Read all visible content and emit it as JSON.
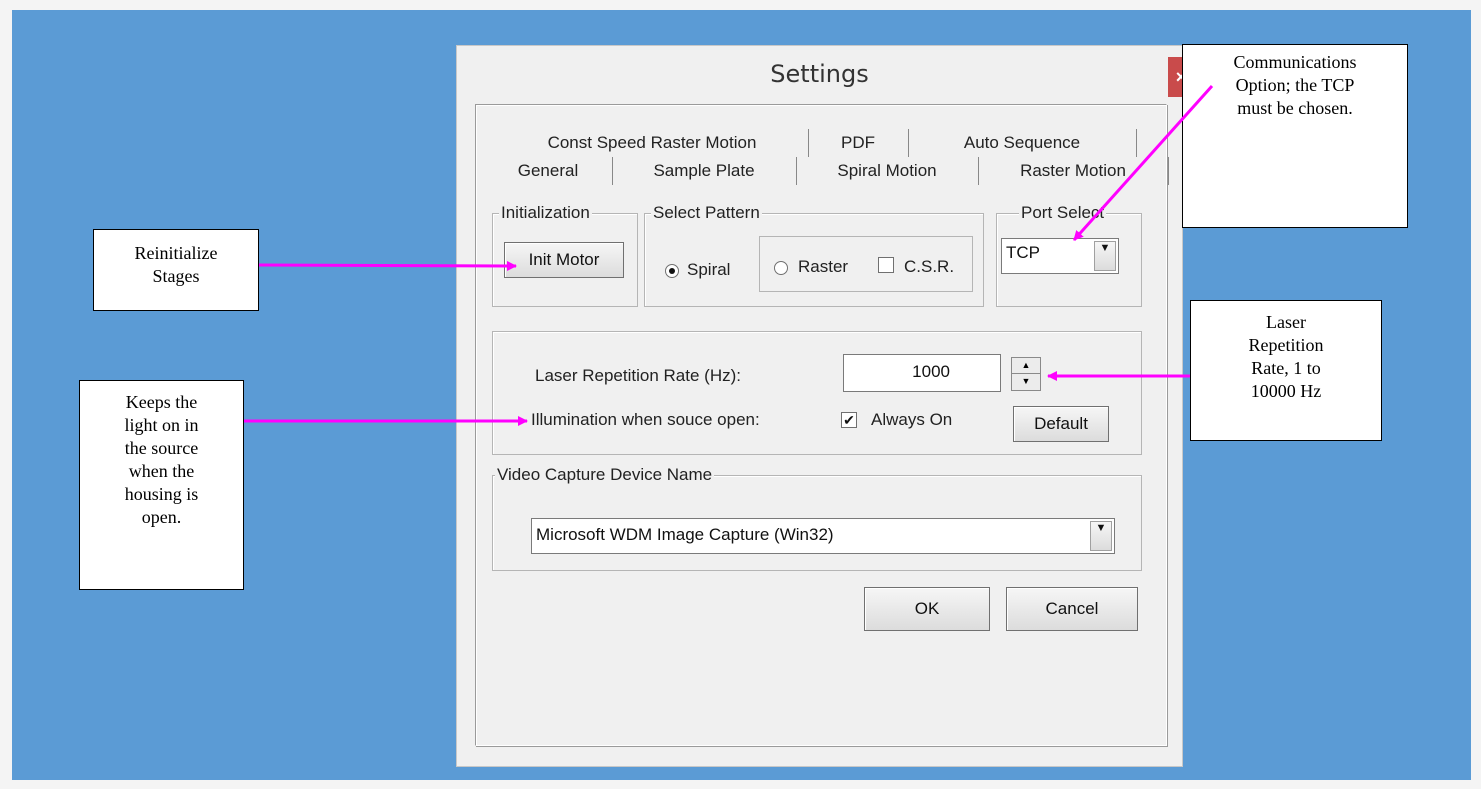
{
  "dialog": {
    "title": "Settings",
    "close_label": "×",
    "tabs_back": [
      "Const Speed Raster Motion",
      "PDF",
      "Auto Sequence"
    ],
    "tabs_front": [
      "General",
      "Sample Plate",
      "Spiral Motion",
      "Raster Motion"
    ],
    "active_tab": "General"
  },
  "initialization": {
    "title": "Initialization",
    "button_label": "Init Motor"
  },
  "select_pattern": {
    "title": "Select Pattern",
    "spiral_label": "Spiral",
    "raster_label": "Raster",
    "csr_label": "C.S.R.",
    "selected": "Spiral"
  },
  "port_select": {
    "title": "Port Select",
    "value": "TCP"
  },
  "laser": {
    "label": "Laser Repetition Rate (Hz):",
    "value": "1000"
  },
  "illumination": {
    "label": "Illumination when souce open:",
    "checkbox_label": "Always On",
    "checked": true,
    "checkmark": "✔",
    "default_label": "Default"
  },
  "video": {
    "title": "Video Capture Device Name",
    "value": "Microsoft WDM Image Capture (Win32)"
  },
  "buttons": {
    "ok": "OK",
    "cancel": "Cancel"
  },
  "annotations": {
    "reinit": [
      "Reinitialize",
      "Stages"
    ],
    "comm": [
      "Communications",
      "Option; the TCP",
      "must be chosen."
    ],
    "laser": [
      "Laser",
      "Repetition",
      "Rate, 1 to",
      "10000 Hz"
    ],
    "light": [
      "Keeps the",
      "light on in",
      "the source",
      "when the",
      "housing is",
      "open."
    ]
  },
  "colors": {
    "background": "#5b9bd5",
    "arrow": "#ff00ff",
    "close": "#c94b4b"
  }
}
